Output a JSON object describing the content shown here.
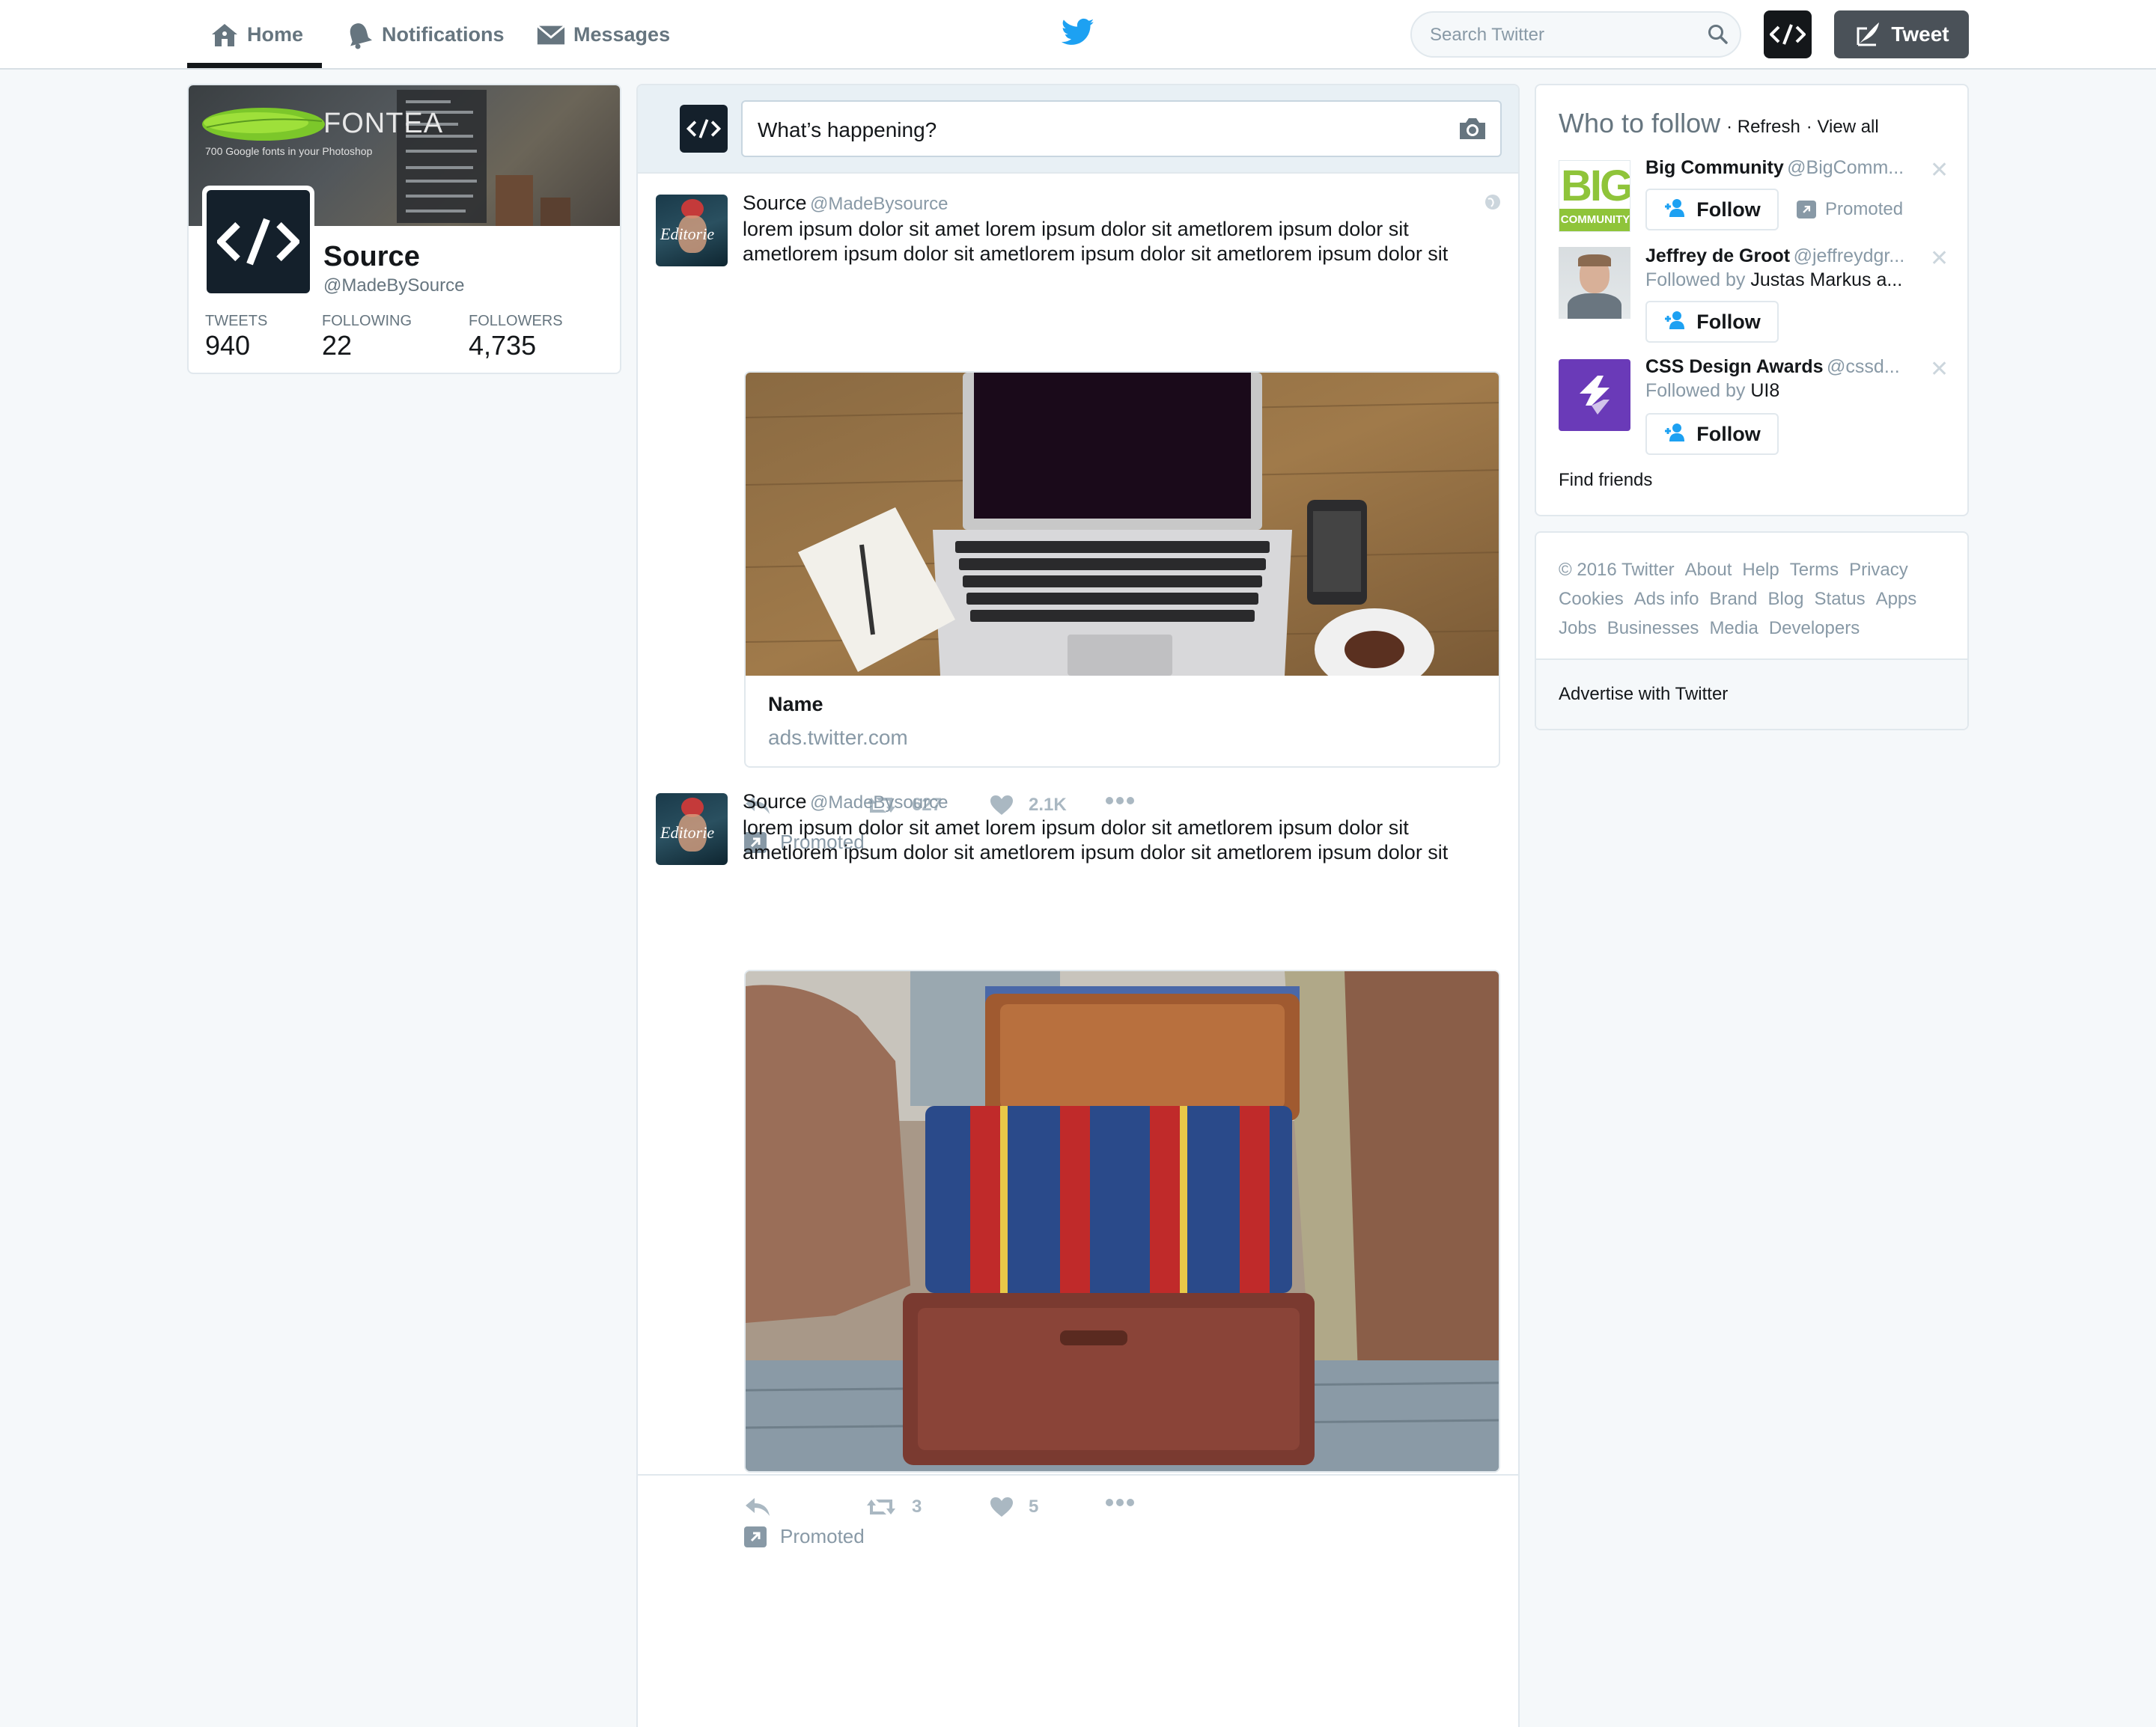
{
  "nav": {
    "home": "Home",
    "notifications": "Notifications",
    "messages": "Messages",
    "search_placeholder": "Search Twitter",
    "tweet_button": "Tweet"
  },
  "profile": {
    "banner_brand": "FONTEA",
    "banner_tagline": "700 Google fonts in your Photoshop",
    "name": "Source",
    "handle": "@MadeBySource",
    "stats": [
      {
        "label": "TWEETS",
        "value": "940"
      },
      {
        "label": "FOLLOWING",
        "value": "22"
      },
      {
        "label": "FOLLOWERS",
        "value": "4,735"
      }
    ]
  },
  "compose": {
    "placeholder": "What’s happening?"
  },
  "tweets": [
    {
      "name": "Source",
      "handle": "@MadeBysource",
      "avatar_text": "Editorie",
      "text": "lorem ipsum dolor sit amet lorem ipsum dolor sit ametlorem ipsum dolor sit ametlorem ipsum dolor sit ametlorem ipsum dolor sit ametlorem ipsum dolor sit",
      "card_title": "Name",
      "card_url": "ads.twitter.com",
      "retweets": "627",
      "likes": "2.1K",
      "promoted": "Promoted"
    },
    {
      "name": "Source",
      "handle": "@MadeBysource",
      "avatar_text": "Editorie",
      "text": "lorem ipsum dolor sit amet lorem ipsum dolor sit ametlorem ipsum dolor sit ametlorem ipsum dolor sit ametlorem ipsum dolor sit ametlorem ipsum dolor sit",
      "retweets": "3",
      "likes": "5",
      "promoted": "Promoted"
    }
  ],
  "who_to_follow": {
    "title": "Who to follow",
    "refresh": "· Refresh",
    "view_all": "· View all",
    "suggestions": [
      {
        "name": "Big Community",
        "handle": "@BigComm...",
        "sub": "Promoted",
        "follow": "Follow",
        "avatar_text": "BIG",
        "avatar_sub": "COMMUNITY"
      },
      {
        "name": "Jeffrey de Groot",
        "handle": "@jeffreydgr...",
        "sub_prefix": "Followed by",
        "sub_name": "Justas Markus a...",
        "follow": "Follow"
      },
      {
        "name": "CSS Design Awards",
        "handle": "@cssd...",
        "sub_prefix": "Followed by",
        "sub_name": "UI8",
        "follow": "Follow"
      }
    ],
    "find_friends": "Find friends"
  },
  "footer": {
    "links_row1": [
      "© 2016 Twitter",
      "About",
      "Help",
      "Terms",
      "Privacy"
    ],
    "links_row2": [
      "Cookies",
      "Ads info",
      "Brand",
      "Blog",
      "Status",
      "Apps"
    ],
    "links_row3": [
      "Jobs",
      "Businesses",
      "Media",
      "Developers"
    ],
    "advertise": "Advertise with Twitter"
  }
}
